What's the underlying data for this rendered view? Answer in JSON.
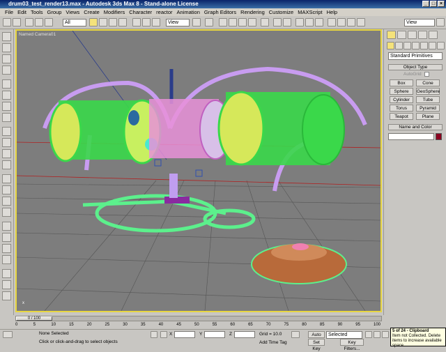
{
  "window": {
    "title": "drum03_test_render13.max - Autodesk 3ds Max 8 - Stand-alone License"
  },
  "menu": [
    "File",
    "Edit",
    "Tools",
    "Group",
    "Views",
    "Create",
    "Modifiers",
    "Character",
    "reactor",
    "Animation",
    "Graph Editors",
    "Rendering",
    "Customize",
    "MAXScript",
    "Help"
  ],
  "toolbar": {
    "selection_filter": "All",
    "ref_coord": "View",
    "named_sel": "View"
  },
  "viewport": {
    "label": "Named Camera01"
  },
  "command_panel": {
    "category": "Standard Primitives",
    "object_type_header": "Object Type",
    "autogrid_label": "AutoGrid",
    "primitives": [
      "Box",
      "Cone",
      "Sphere",
      "GeoSphere",
      "Cylinder",
      "Tube",
      "Torus",
      "Pyramid",
      "Teapot",
      "Plane"
    ],
    "name_color_header": "Name and Color",
    "color": "#8b0020"
  },
  "timeline": {
    "slider_label": "0 / 100",
    "ticks": [
      "0",
      "5",
      "10",
      "15",
      "20",
      "25",
      "30",
      "35",
      "40",
      "45",
      "50",
      "55",
      "60",
      "65",
      "70",
      "75",
      "80",
      "85",
      "90",
      "95",
      "100"
    ]
  },
  "status": {
    "selection": "None Selected",
    "prompt": "Click or click-and-drag to select objects",
    "x_label": "X",
    "y_label": "Y",
    "z_label": "Z",
    "grid": "Grid = 10.0",
    "add_time_tag": "Add Time Tag",
    "auto_key": "Auto Key",
    "set_key": "Set Key",
    "key_mode": "Selected",
    "key_filters": "Key Filters..."
  },
  "clipboard": {
    "title": "5 of 24 - Clipboard",
    "message": "Item not Collected. Delete items to increase available space"
  },
  "colors": {
    "viewport_border": "#e8d640",
    "viewport_bg": "#7d7d7d",
    "wire_green": "#4cff4c",
    "wire_violet": "#c89cf0"
  }
}
